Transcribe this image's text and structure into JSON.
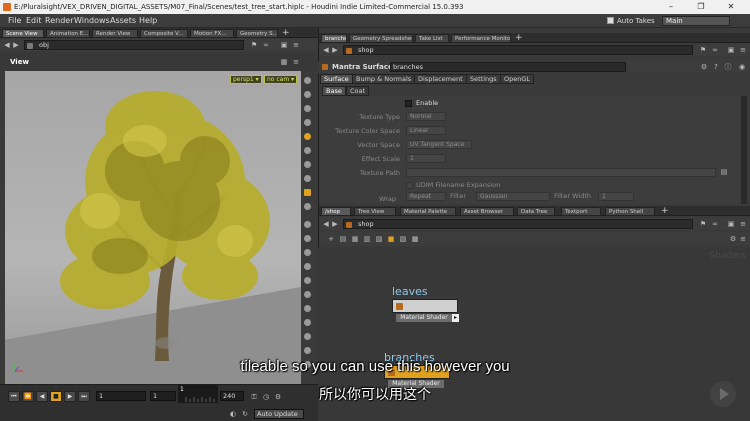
{
  "window": {
    "title": "E:/Pluralsight/VEX_DRIVEN_DIGITAL_ASSETS/M07_Final/Scenes/test_tree_start.hiplc - Houdini Indie Limited-Commercial 15.0.393",
    "minimize": "–",
    "maximize": "❐",
    "close": "✕"
  },
  "menubar": {
    "items": [
      "File",
      "Edit",
      "Render",
      "Windows",
      "Assets",
      "Help"
    ],
    "auto_takes_label": "Auto Takes",
    "desktop": "Main"
  },
  "left_tabs": [
    "Scene View",
    "Animation E...",
    "Render View",
    "Composite V...",
    "Motion FX...",
    "Geometry S..."
  ],
  "left_path": "obj",
  "viewport": {
    "label": "View",
    "persp": "persp1 ▾",
    "cam": "no cam ▾"
  },
  "playbar": {
    "start_frame": "1",
    "current_frame": "1",
    "end_frame": "240",
    "range_start": "1",
    "frame_box": "1",
    "auto_update": "Auto Update"
  },
  "right_top_tabs": [
    "branches",
    "Geometry Spreadsheet",
    "Take List",
    "Performance Monitor"
  ],
  "right_top_path": "shop",
  "parameter_panel": {
    "node_type": "Mantra Surface",
    "node_name": "branches",
    "tabs": [
      "Surface",
      "Bump & Normals",
      "Displacement",
      "Settings",
      "OpenGL"
    ],
    "sub_tabs": [
      "Base",
      "Coat"
    ],
    "enable_label": "Enable",
    "rows": [
      {
        "label": "Texture Type",
        "value": "Normal"
      },
      {
        "label": "Texture Color Space",
        "value": "Linear"
      },
      {
        "label": "Vector Space",
        "value": "UV Tangent Space"
      },
      {
        "label": "Effect Scale",
        "value": "1"
      },
      {
        "label": "Texture Path",
        "value": ""
      }
    ],
    "udim_label": "UDIM Filename Expansion",
    "wrap_label": "Wrap",
    "wrap_value": "Repeat",
    "filter_label": "Filter",
    "filter_value": "Gaussian",
    "filter_width_label": "Filter Width",
    "filter_width_value": "1"
  },
  "right_bottom_tabs": [
    "/shop",
    "Tree View",
    "Material Palette",
    "Asset Browser",
    "Data Tree",
    "Textport",
    "Python Shell"
  ],
  "right_bottom_path": "shop",
  "network": {
    "context_label": "Shaders",
    "nodes": [
      {
        "name": "leaves",
        "type": "Material Shader"
      },
      {
        "name": "branches",
        "type": "Material Shader"
      }
    ]
  },
  "subtitles": {
    "english": "tileable so you can use this however you",
    "chinese": "所以你可以用这个"
  },
  "colors": {
    "accent_orange": "#e0a11e",
    "node_name_blue": "#8fc7ea",
    "cam_label_green": "#d8e06a"
  }
}
